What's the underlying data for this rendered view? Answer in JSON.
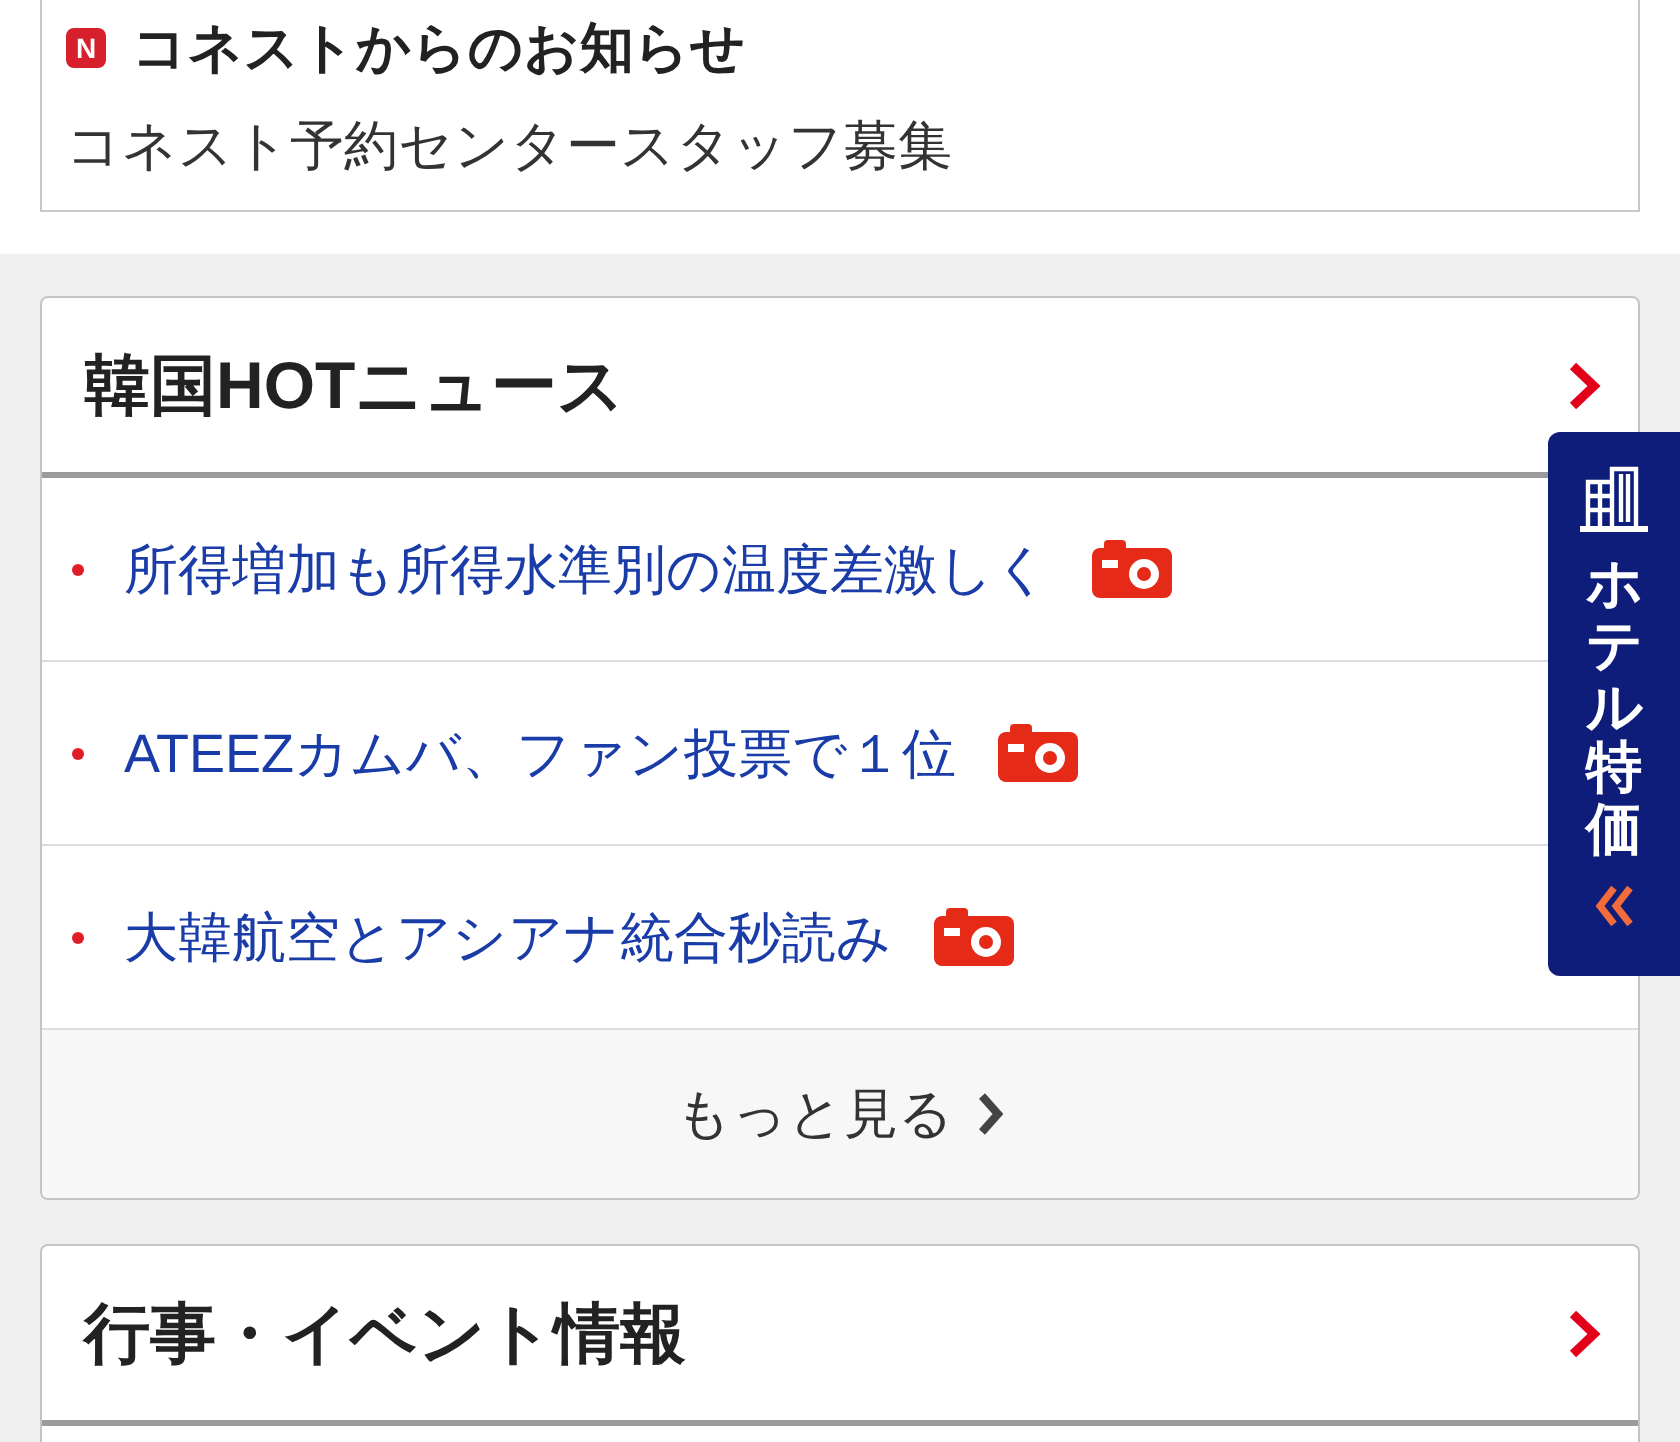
{
  "notice": {
    "badge": "N",
    "title": "コネストからのお知らせ",
    "link": "コネスト予約センタースタッフ募集"
  },
  "sections": [
    {
      "title": "韓国HOTニュース",
      "items": [
        {
          "text": "所得増加も所得水準別の温度差激しく",
          "photo": true
        },
        {
          "text": "ATEEZカムバ、ファン投票で１位",
          "photo": true
        },
        {
          "text": "大韓航空とアシアナ統合秒読み",
          "photo": true
        }
      ],
      "more": "もっと見る"
    },
    {
      "title": "行事・イベント情報"
    }
  ],
  "hotel_tab": {
    "label": "ホテル特価"
  }
}
